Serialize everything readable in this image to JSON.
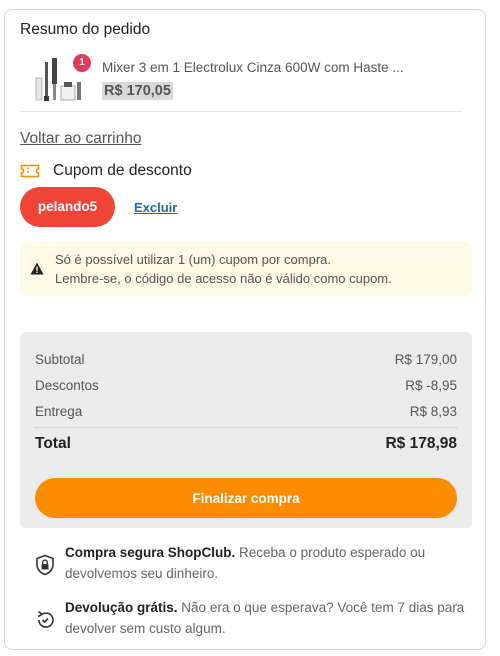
{
  "summary_title": "Resumo do pedido",
  "product": {
    "quantity": "1",
    "name": "Mixer 3 em 1 Electrolux Cinza 600W com Haste ...",
    "price": "R$ 170,05"
  },
  "back_link": "Voltar ao carrinho",
  "coupon": {
    "title": "Cupom de desconto",
    "code": "pelando5",
    "remove_label": "Excluir"
  },
  "notice": {
    "line1": "Só é possível utilizar 1 (um) cupom por compra.",
    "line2": "Lembre-se, o código de acesso não é válido como cupom."
  },
  "totals": {
    "subtotal_label": "Subtotal",
    "subtotal_value": "R$ 179,00",
    "discounts_label": "Descontos",
    "discounts_value": "R$ -8,95",
    "delivery_label": "Entrega",
    "delivery_value": "R$ 8,93",
    "total_label": "Total",
    "total_value": "R$ 178,98"
  },
  "checkout_label": "Finalizar compra",
  "benefits": [
    {
      "icon": "shield-lock-icon",
      "title": "Compra segura ShopClub.",
      "text": " Receba o produto esperado ou devolvemos seu dinheiro."
    },
    {
      "icon": "return-box-icon",
      "title": "Devolução grátis.",
      "text": " Não era o que esperava? Você tem 7 dias para devolver sem custo algum."
    }
  ],
  "colors": {
    "coupon_chip": "#f04438",
    "checkout_button": "#fb8c00",
    "link": "#1b6ea3",
    "badge": "#e23a5c",
    "notice_bg": "#fef8e5"
  }
}
